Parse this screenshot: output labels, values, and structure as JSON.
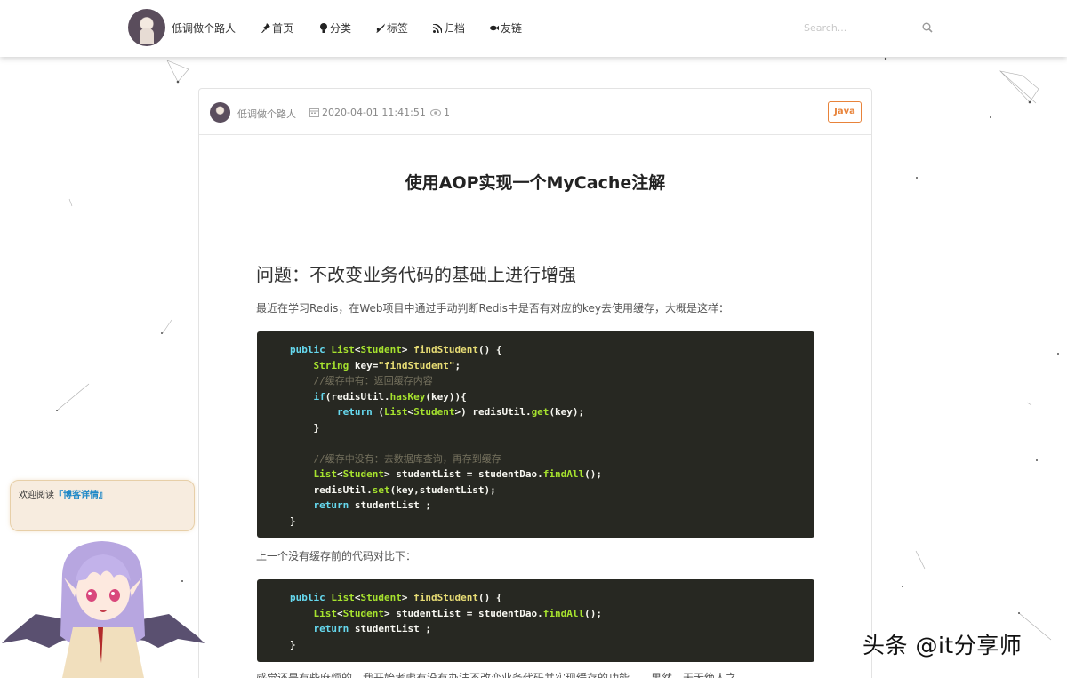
{
  "header": {
    "site_name": "低调做个路人",
    "nav": [
      {
        "label": "首页",
        "icon": "pin-icon"
      },
      {
        "label": "分类",
        "icon": "bulb-icon"
      },
      {
        "label": "标签",
        "icon": "tag-icon"
      },
      {
        "label": "归档",
        "icon": "rss-icon"
      },
      {
        "label": "友链",
        "icon": "fish-icon"
      }
    ],
    "search_placeholder": "Search..."
  },
  "article": {
    "author": "低调做个路人",
    "date": "2020-04-01 11:41:51",
    "views": "1",
    "tag": "Java",
    "title": "使用AOP实现一个MyCache注解",
    "section_heading": "问题：不改变业务代码的基础上进行增强",
    "paragraph1": "最近在学习Redis，在Web项目中通过手动判断Redis中是否有对应的key去使用缓存，大概是这样：",
    "paragraph2": "上一个没有缓存前的代码对比下：",
    "paragraph3": "感觉还是有些麻烦的，我开始考虑有没有办法不改变业务代码并实现缓存的功能……果然，天无绝人之",
    "code1": [
      "public List<Student> findStudent() {",
      "    String key=\"findStudent\";",
      "    //缓存中有：返回缓存内容",
      "    if(redisUtil.hasKey(key)){",
      "        return (List<Student>) redisUtil.get(key);",
      "    }",
      "",
      "    //缓存中没有：去数据库查询，再存到缓存",
      "    List<Student> studentList = studentDao.findAll();",
      "    redisUtil.set(key,studentList);",
      "    return studentList ;",
      "}"
    ],
    "code2": [
      "public List<Student> findStudent() {",
      "    List<Student> studentList = studentDao.findAll();",
      "    return studentList ;",
      "}"
    ]
  },
  "widget": {
    "bubble_prefix": "欢迎阅读",
    "bubble_link": "『博客详情』"
  },
  "watermark": "头条 @it分享师",
  "colors": {
    "accent_tag": "#e8833a",
    "code_bg": "#272822",
    "link": "#1e88c7"
  }
}
